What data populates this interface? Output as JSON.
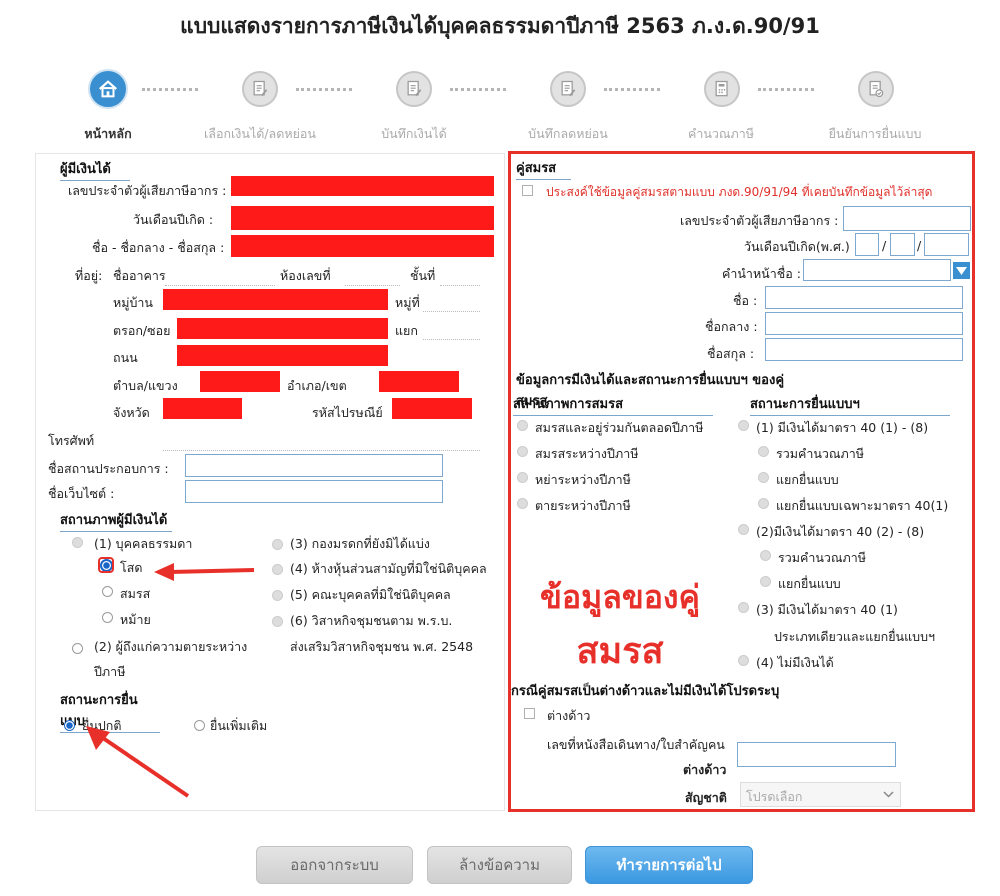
{
  "page_title": "แบบแสดงรายการภาษีเงินได้บุคคลธรรมดาปีภาษี 2563 ภ.ง.ด.90/91",
  "steps": [
    {
      "label": "หน้าหลัก",
      "icon": "home-icon",
      "active": true
    },
    {
      "label": "เลือกเงินได้/ลดหย่อน",
      "icon": "edit-document-icon",
      "active": false
    },
    {
      "label": "บันทึกเงินได้",
      "icon": "edit-document-icon",
      "active": false
    },
    {
      "label": "บันทึกลดหย่อน",
      "icon": "edit-document-icon",
      "active": false
    },
    {
      "label": "คำนวณภาษี",
      "icon": "calculator-document-icon",
      "active": false
    },
    {
      "label": "ยืนยันการยื่นแบบ",
      "icon": "confirm-document-icon",
      "active": false
    }
  ],
  "taxpayer": {
    "section_title": "ผู้มีเงินได้",
    "tax_id_label": "เลขประจำตัวผู้เสียภาษีอากร :",
    "birthdate_label": "วันเดือนปีเกิด :",
    "name_label": "ชื่อ - ชื่อกลาง - ชื่อสกุล :",
    "address_label": "ที่อยู่:",
    "building_label": "ชื่ออาคาร",
    "room_label": "ห้องเลขที่",
    "floor_label": "ชั้นที่",
    "village_label": "หมู่บ้าน",
    "moo_label": "หมู่ที่",
    "soi_label": "ตรอก/ซอย",
    "yaek_label": "แยก",
    "road_label": "ถนน",
    "subdistrict_label": "ตำบล/แขวง",
    "district_label": "อำเภอ/เขต",
    "province_label": "จังหวัด",
    "postcode_label": "รหัสไปรษณีย์",
    "phone_label": "โทรศัพท์",
    "business_label": "ชื่อสถานประกอบการ :",
    "website_label": "ชื่อเว็บไซต์ :",
    "status_title": "สถานภาพผู้มีเงินได้",
    "status_options": {
      "person": "(1) บุคคลธรรมดา",
      "single": "โสด",
      "married": "สมรส",
      "widowed": "หม้าย",
      "deceased": "(2) ผู้ถึงแก่ความตายระหว่าง",
      "deceased_2": "ปีภาษี",
      "estate": "(3) กองมรดกที่ยังมิได้แบ่ง",
      "partnership": "(4) ห้างหุ้นส่วนสามัญที่มิใช่นิติบุคคล",
      "group": "(5) คณะบุคคลที่มิใช่นิติบุคคล",
      "community": "(6) วิสาหกิจชุมชนตาม พ.ร.บ.",
      "community_2": "ส่งเสริมวิสาหกิจชุมชน พ.ศ. 2548"
    },
    "filing_title": "สถานะการยื่นแบบ",
    "filing_normal": "ยื่นปกติ",
    "filing_additional": "ยื่นเพิ่มเติม"
  },
  "spouse": {
    "section_title": "คู่สมรส",
    "use_prev_label": "ประสงค์ใช้ข้อมูลคู่สมรสตามแบบ ภงด.90/91/94 ที่เคยบันทึกข้อมูลไว้ล่าสุด",
    "tax_id_label": "เลขประจำตัวผู้เสียภาษีอากร :",
    "birthdate_label": "วันเดือนปีเกิด(พ.ศ.)",
    "date_sep": "/",
    "prefix_label": "คำนำหน้าชื่อ :",
    "first_label": "ชื่อ :",
    "middle_label": "ชื่อกลาง :",
    "last_label": "ชื่อสกุล :",
    "income_title": "ข้อมูลการมีเงินได้และสถานะการยื่นแบบฯ ของคู่สมรส",
    "marital_title": "สถานภาพการสมรส",
    "marital_options": [
      "สมรสและอยู่ร่วมกันตลอดปีภาษี",
      "สมรสระหว่างปีภาษี",
      "หย่าระหว่างปีภาษี",
      "ตายระหว่างปีภาษี"
    ],
    "filing_title": "สถานะการยื่นแบบฯ",
    "filing_options": {
      "o1": "(1) มีเงินได้มาตรา 40 (1) - (8)",
      "o1a": "รวมคำนวณภาษี",
      "o1b": "แยกยื่นแบบ",
      "o1c": "แยกยื่นแบบเฉพาะมาตรา 40(1)",
      "o2": "(2)มีเงินได้มาตรา 40 (2) - (8)",
      "o2a": "รวมคำนวณภาษี",
      "o2b": "แยกยื่นแบบ",
      "o3": "(3) มีเงินได้มาตรา 40 (1)",
      "o3b": "ประเภทเดียวและแยกยื่นแบบฯ",
      "o4": "(4) ไม่มีเงินได้"
    },
    "foreign_title": "กรณีคู่สมรสเป็นต่างด้าวและไม่มีเงินได้โปรดระบุ",
    "foreign_label": "ต่างด้าว",
    "passport_label": "เลขที่หนังสือเดินทาง/ใบสำคัญคน",
    "passport_label_2": "ต่างด้าว",
    "nationality_label": "สัญชาติ",
    "nationality_placeholder": "โปรดเลือก",
    "overlay_line1": "ข้อมูลของคู่",
    "overlay_line2": "สมรส"
  },
  "buttons": {
    "logout": "ออกจากระบบ",
    "clear": "ล้างข้อความ",
    "next": "ทำรายการต่อไป"
  },
  "colors": {
    "accent": "#3a8fd0",
    "redact": "#ff1a1a",
    "highlight": "#e8302a"
  }
}
